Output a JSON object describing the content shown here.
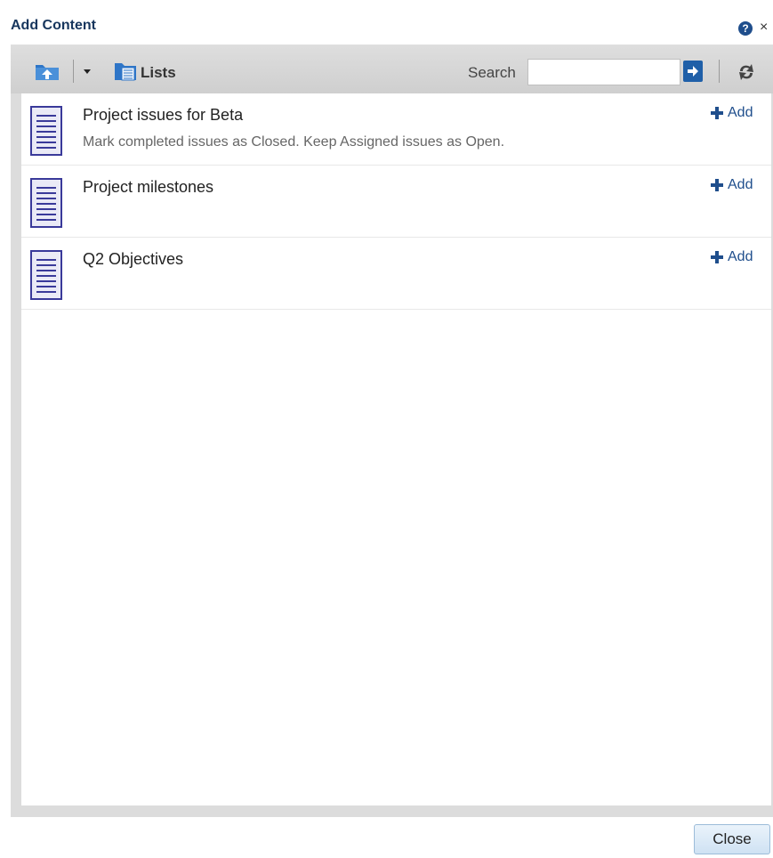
{
  "dialog": {
    "title": "Add Content",
    "help_icon": "help-icon",
    "close_glyph": "×"
  },
  "toolbar": {
    "up_icon": "folder-up-icon",
    "dropdown_icon": "chevron-down-icon",
    "location_icon": "lists-folder-icon",
    "location_label": "Lists",
    "search_label": "Search",
    "search_value": "",
    "search_placeholder": "",
    "search_go_icon": "arrow-right-icon",
    "refresh_icon": "refresh-icon"
  },
  "items": [
    {
      "title": "Project issues for Beta",
      "description": "Mark completed issues as Closed. Keep Assigned issues as Open.",
      "add_label": "Add",
      "icon": "list-document-icon"
    },
    {
      "title": "Project milestones",
      "description": "",
      "add_label": "Add",
      "icon": "list-document-icon"
    },
    {
      "title": "Q2 Objectives",
      "description": "",
      "add_label": "Add",
      "icon": "list-document-icon"
    }
  ],
  "footer": {
    "close_label": "Close"
  },
  "colors": {
    "title": "#17365d",
    "link": "#1f4e8c",
    "accent": "#1f5fa8",
    "frame": "#dcdcdc"
  }
}
